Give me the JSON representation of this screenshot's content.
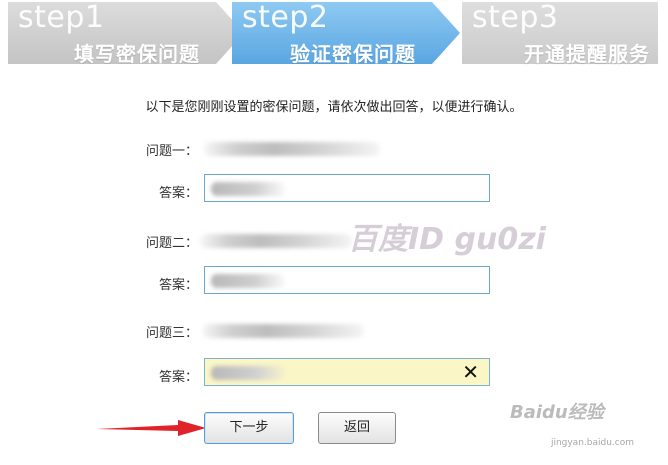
{
  "steps": [
    {
      "num": "step1",
      "label": "填写密保问题",
      "state": "done"
    },
    {
      "num": "step2",
      "label": "验证密保问题",
      "state": "active"
    },
    {
      "num": "step3",
      "label": "开通提醒服务",
      "state": "pending"
    }
  ],
  "intro": "以下是您刚刚设置的密保问题，请依次做出回答，以便进行确认。",
  "questions": [
    {
      "label": "问题一：",
      "answer_label": "答案："
    },
    {
      "label": "问题二：",
      "answer_label": "答案："
    },
    {
      "label": "问题三：",
      "answer_label": "答案："
    }
  ],
  "buttons": {
    "next": "下一步",
    "back": "返回"
  },
  "watermark": "百度ID gu0zi",
  "baidu": {
    "brand": "Baidu经验",
    "url": "jingyan.baidu.com"
  },
  "colors": {
    "active_step": "#5aa6e2",
    "inactive_step": "#c8c8c8",
    "focus_field": "#fbf6c6",
    "arrow": "#e0232b"
  }
}
